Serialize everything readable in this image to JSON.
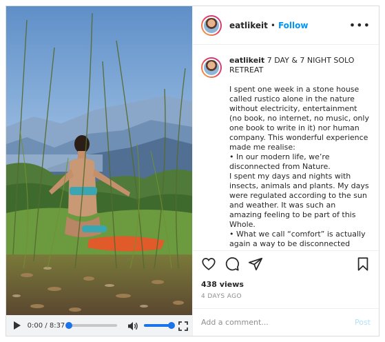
{
  "video": {
    "time_display": "0:00 / 8:37",
    "progress_fraction": 0.0,
    "volume_fraction": 1.0,
    "icons": {
      "play": "play-icon",
      "volume": "volume-icon",
      "fullscreen": "fullscreen-icon"
    },
    "accent_color": "#1a73e8"
  },
  "header": {
    "username": "eatlikeit",
    "separator": "•",
    "follow_label": "Follow",
    "more_icon": "more-options-icon"
  },
  "caption": {
    "username": "eatlikeit",
    "title": "7 DAY & 7 NIGHT SOLO RETREAT",
    "lines": [
      "I spent one week in a stone house called rustico alone in the nature without electricity, entertainment (no book, no internet, no music, only one book to write in it) nor human company. This wonderful experience made me realise:",
      "• In our modern life, we’re disconnected from Nature.",
      "I spent my days and nights with insects, animals and plants. My days were regulated according to the sun and weather. It was such an amazing feeling to be part of this Whole.",
      "• What we call “comfort” is actually again a way to be disconnected from Nature."
    ]
  },
  "actions": {
    "icons": [
      "heart-icon",
      "comment-icon",
      "share-icon",
      "bookmark-icon"
    ],
    "views": "438 views",
    "age": "4 DAYS AGO"
  },
  "comment": {
    "placeholder": "Add a comment...",
    "post_label": "Post",
    "post_color": "#b2dffc"
  },
  "colors": {
    "follow": "#0095f6",
    "border": "#dbdbdb"
  }
}
